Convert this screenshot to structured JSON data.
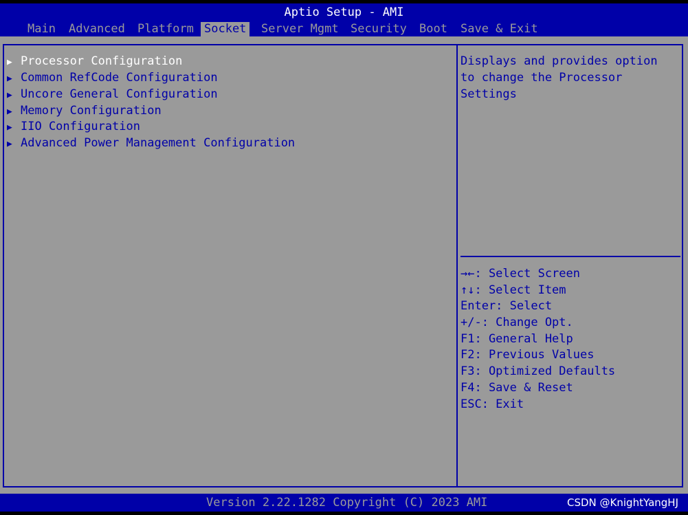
{
  "title": "Aptio Setup - AMI",
  "tabs": [
    {
      "label": "Main",
      "active": false
    },
    {
      "label": "Advanced",
      "active": false
    },
    {
      "label": "Platform",
      "active": false
    },
    {
      "label": "Socket",
      "active": true
    },
    {
      "label": "Server Mgmt",
      "active": false
    },
    {
      "label": "Security",
      "active": false
    },
    {
      "label": "Boot",
      "active": false
    },
    {
      "label": "Save & Exit",
      "active": false
    }
  ],
  "menu": {
    "arrow_glyph": "▶",
    "items": [
      {
        "label": "Processor Configuration",
        "selected": true
      },
      {
        "label": "Common RefCode Configuration",
        "selected": false
      },
      {
        "label": "Uncore General Configuration",
        "selected": false
      },
      {
        "label": "Memory Configuration",
        "selected": false
      },
      {
        "label": "IIO Configuration",
        "selected": false
      },
      {
        "label": "Advanced Power Management Configuration",
        "selected": false
      }
    ]
  },
  "help": {
    "lines": [
      "Displays and provides option",
      "to change the Processor",
      "Settings"
    ]
  },
  "keys": {
    "lines": [
      "→←: Select Screen",
      "↑↓: Select Item",
      "Enter: Select",
      "+/-: Change Opt.",
      "F1: General Help",
      "F2: Previous Values",
      "F3: Optimized Defaults",
      "F4: Save & Reset",
      "ESC: Exit"
    ]
  },
  "footer": {
    "version": "Version 2.22.1282 Copyright (C) 2023 AMI",
    "watermark": "CSDN @KnightYangHJ"
  },
  "colors": {
    "background": "#9a9a9a",
    "accent": "#0000a8",
    "highlight": "#ffffff"
  }
}
